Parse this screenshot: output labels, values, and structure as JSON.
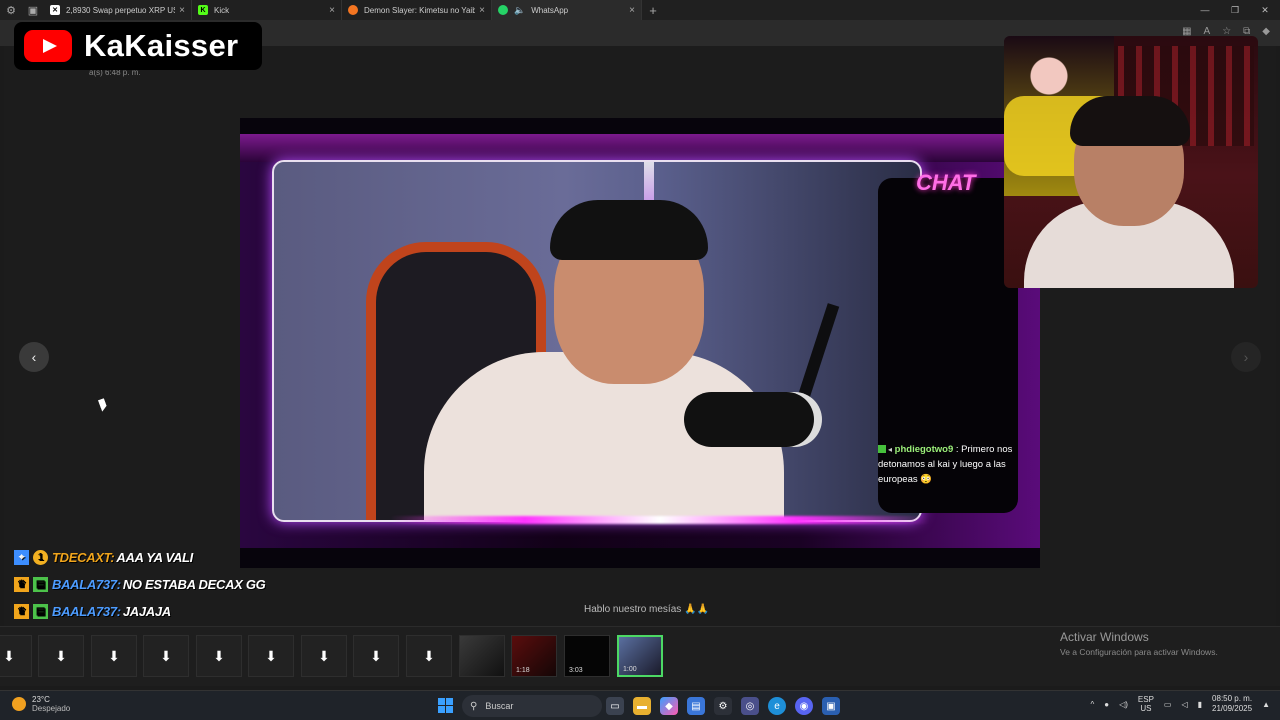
{
  "browser": {
    "tabs": [
      {
        "title": "2,8930 Swap perpetuo XRP USD |",
        "favicon": "x-icon"
      },
      {
        "title": "Kick",
        "favicon": "kick-icon"
      },
      {
        "title": "Demon Slayer: Kimetsu no Yaiba |",
        "favicon": "crunchyroll-icon"
      },
      {
        "title": "WhatsApp",
        "favicon": "whatsapp-icon"
      }
    ]
  },
  "page": {
    "timestamp": "a(s) 6:48 p. m.",
    "caption": "Hablo nuestro mesías 🙏🙏"
  },
  "youtube_overlay": {
    "channel_name": "KaKaisser"
  },
  "stream": {
    "chat_title": "CHAT",
    "chat_message": {
      "user": "phdiegotwo9",
      "separator": " : ",
      "text": "Primero nos detonamos al kai y luego a las europeas 😳"
    }
  },
  "kick_chat": [
    {
      "user": "TDECAXT:",
      "message": "AAA YA VALI",
      "badges": [
        "verified-icon",
        "level-badge-icon"
      ],
      "badge_text": "1"
    },
    {
      "user": "BAALA737:",
      "message": "NO ESTABA DECAX GG",
      "badges": [
        "crown-icon",
        "gift-icon"
      ]
    },
    {
      "user": "BAALA737:",
      "message": "JAJAJA",
      "badges": [
        "crown-icon",
        "gift-icon"
      ]
    }
  ],
  "thumbnails": {
    "durations": [
      "1:18",
      "3:03",
      "1:00"
    ]
  },
  "windows_watermark": {
    "title": "Activar Windows",
    "subtitle": "Ve a Configuración para activar Windows."
  },
  "taskbar": {
    "weather_temp": "23°C",
    "weather_desc": "Despejado",
    "search_placeholder": "Buscar",
    "lang_top": "ESP",
    "lang_bottom": "US",
    "time": "08:50 p. m.",
    "date": "21/09/2025"
  },
  "colors": {
    "accent_purple": "#b84bff",
    "chat_title": "#ff6ee6",
    "kick_green": "#4cc24a",
    "user_gold": "#f1a51c",
    "user_blue": "#4d9cff",
    "youtube_red": "#ff0000"
  }
}
